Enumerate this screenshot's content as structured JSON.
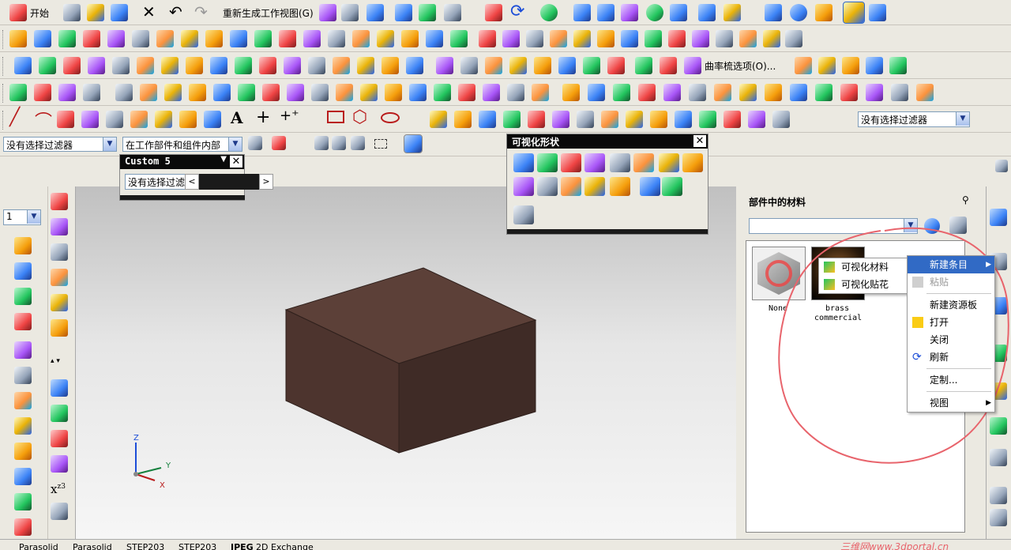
{
  "toolbar1": {
    "start_label": "开始",
    "regenerate_label": "重新生成工作视图(G)"
  },
  "toolbar3": {
    "curvature_label": "曲率梳选项(O)..."
  },
  "toolbar5": {
    "filter_right": "没有选择过滤器"
  },
  "selbar": {
    "filter_value": "没有选择过滤器",
    "scope_value": "在工作部件和组件内部"
  },
  "custom5": {
    "title": "Custom 5",
    "filter_value": "没有选择过滤"
  },
  "viz_shape": {
    "title": "可视化形状"
  },
  "left_dock": {
    "layer_value": "1"
  },
  "triad": {
    "x": "X",
    "y": "Y",
    "z": "Z"
  },
  "materials_panel": {
    "title": "部件中的材料",
    "items": [
      {
        "label": "None"
      },
      {
        "label_line1": "brass",
        "label_line2": "commercial"
      }
    ]
  },
  "submenu": {
    "items": [
      "可视化材料",
      "可视化贴花"
    ]
  },
  "context_menu": {
    "new_entry": "新建条目",
    "paste": "粘贴",
    "new_palette": "新建资源板",
    "open": "打开",
    "close": "关闭",
    "refresh": "刷新",
    "customize": "定制...",
    "view": "视图"
  },
  "statusbar": {
    "items": [
      "Parasolid",
      "Parasolid",
      "STEP203",
      "STEP203",
      "JPEG",
      "2D Exchange"
    ]
  },
  "watermark": "三维网www.3dportal.cn",
  "colors": {
    "box_top": "#5c4038",
    "box_front": "#4d342e",
    "box_side": "#3f2b26",
    "annotation": "#e8646c",
    "highlight": "#316ac5"
  }
}
